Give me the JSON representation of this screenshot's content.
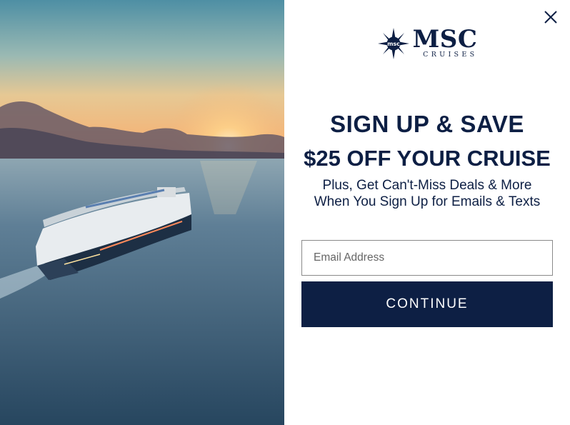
{
  "hero": {
    "image_alt": "MSC cruise ship sailing at sunset"
  },
  "close_icon": "close-icon",
  "logo": {
    "brand": "MSC",
    "sub": "CRUISES",
    "emblem_text": "msc"
  },
  "headline": {
    "line1": "SIGN UP & SAVE",
    "line2": "$25 OFF YOUR CRUISE"
  },
  "subtext": {
    "line1": "Plus, Get Can't-Miss Deals & More",
    "line2": "When You Sign Up for Emails & Texts"
  },
  "form": {
    "email_placeholder": "Email Address",
    "email_value": "",
    "continue_label": "CONTINUE"
  },
  "colors": {
    "brand_navy": "#0d1f44",
    "background": "#ffffff"
  }
}
